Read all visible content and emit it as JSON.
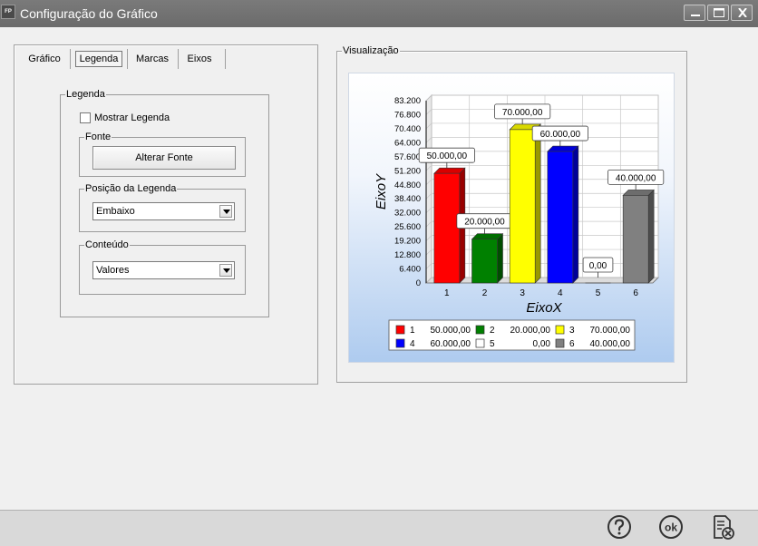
{
  "window": {
    "icon_text": "FP",
    "title": "Configuração do Gráfico"
  },
  "tabs": [
    {
      "label": "Gráfico",
      "active": false
    },
    {
      "label": "Legenda",
      "active": true
    },
    {
      "label": "Marcas",
      "active": false
    },
    {
      "label": "Eixos",
      "active": false
    }
  ],
  "legenda_group": {
    "label": "Legenda",
    "show_legend_label": "Mostrar Legenda",
    "show_legend_checked": false,
    "fonte": {
      "label": "Fonte",
      "button_label": "Alterar Fonte"
    },
    "posicao": {
      "label": "Posição da Legenda",
      "selected": "Embaixo"
    },
    "conteudo": {
      "label": "Conteúdo",
      "selected": "Valores"
    }
  },
  "preview": {
    "label": "Visualização"
  },
  "chart_data": {
    "type": "bar",
    "categories": [
      "1",
      "2",
      "3",
      "4",
      "5",
      "6"
    ],
    "values": [
      50000,
      20000,
      70000,
      60000,
      0,
      40000
    ],
    "value_labels": [
      "50.000,00",
      "20.000,00",
      "70.000,00",
      "60.000,00",
      "0,00",
      "40.000,00"
    ],
    "colors": [
      "#ff0000",
      "#008000",
      "#ffff00",
      "#0000ff",
      "#ffffff",
      "#808080"
    ],
    "xlabel": "EixoX",
    "ylabel": "EixoY",
    "ylim": [
      0,
      83200
    ],
    "yticks": [
      "0",
      "6.400",
      "12.800",
      "19.200",
      "25.600",
      "32.000",
      "38.400",
      "44.800",
      "51.200",
      "57.600",
      "64.000",
      "70.400",
      "76.800",
      "83.200"
    ],
    "grid": true,
    "legend_position": "bottom",
    "legend": [
      {
        "key": "1",
        "value": "50.000,00"
      },
      {
        "key": "2",
        "value": "20.000,00"
      },
      {
        "key": "3",
        "value": "70.000,00"
      },
      {
        "key": "4",
        "value": "60.000,00"
      },
      {
        "key": "5",
        "value": "0,00"
      },
      {
        "key": "6",
        "value": "40.000,00"
      }
    ]
  },
  "footer": {
    "help_icon": "help-icon",
    "ok_icon_text": "ok",
    "cancel_icon": "cancel-document-icon"
  },
  "colors": {
    "titlebar": "#6b6b6b",
    "footer": "#d9d9d9"
  }
}
